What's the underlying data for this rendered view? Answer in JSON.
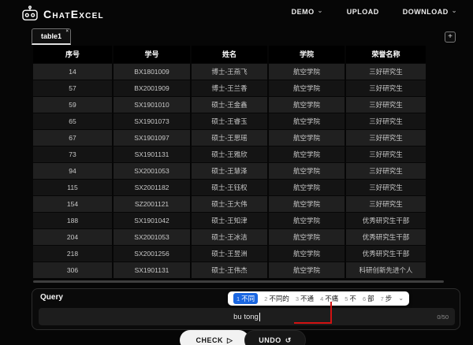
{
  "brand": {
    "p1": "C",
    "p2": "HAT",
    "p3": "E",
    "p4": "XCEL"
  },
  "nav": {
    "demo": "DEMO",
    "upload": "UPLOAD",
    "download": "DOWNLOAD",
    "chevron": "⌄"
  },
  "tabs": {
    "active": "table1",
    "close": "×",
    "add": "+"
  },
  "table": {
    "columns": [
      "序号",
      "学号",
      "姓名",
      "学院",
      "荣誉名称"
    ],
    "rows": [
      [
        "14",
        "BX1801009",
        "博士-王燕飞",
        "航空学院",
        "三好研究生"
      ],
      [
        "57",
        "BX2001909",
        "博士-王兰香",
        "航空学院",
        "三好研究生"
      ],
      [
        "59",
        "SX1901010",
        "硕士-王金鑫",
        "航空学院",
        "三好研究生"
      ],
      [
        "65",
        "SX1901073",
        "硕士-王睿玉",
        "航空学院",
        "三好研究生"
      ],
      [
        "67",
        "SX1901097",
        "硕士-王思瑶",
        "航空学院",
        "三好研究生"
      ],
      [
        "73",
        "SX1901131",
        "硕士-王雅欣",
        "航空学院",
        "三好研究生"
      ],
      [
        "94",
        "SX2001053",
        "硕士-王慧泽",
        "航空学院",
        "三好研究生"
      ],
      [
        "115",
        "SX2001182",
        "硕士-王钰权",
        "航空学院",
        "三好研究生"
      ],
      [
        "154",
        "SZ2001121",
        "硕士-王大伟",
        "航空学院",
        "三好研究生"
      ],
      [
        "188",
        "SX1901042",
        "硕士-王知津",
        "航空学院",
        "优秀研究生干部"
      ],
      [
        "204",
        "SX2001053",
        "硕士-王冰洁",
        "航空学院",
        "优秀研究生干部"
      ],
      [
        "218",
        "SX2001256",
        "硕士-王昱洲",
        "航空学院",
        "优秀研究生干部"
      ],
      [
        "306",
        "SX1901131",
        "硕士-王伟杰",
        "航空学院",
        "科研创新先进个人"
      ]
    ]
  },
  "query": {
    "label": "Query",
    "input_value": "bu tong",
    "char_counter": "0/50"
  },
  "ime": {
    "candidates": [
      {
        "num": "1",
        "text": "不同",
        "selected": true
      },
      {
        "num": "2",
        "text": "不同的",
        "selected": false
      },
      {
        "num": "3",
        "text": "不通",
        "selected": false
      },
      {
        "num": "4",
        "text": "不痛",
        "selected": false
      },
      {
        "num": "5",
        "text": "不",
        "selected": false
      },
      {
        "num": "6",
        "text": "部",
        "selected": false
      },
      {
        "num": "7",
        "text": "步",
        "selected": false
      }
    ],
    "chevron": "⌄",
    "highlight_color": "#1a66e0"
  },
  "actions": {
    "check": "CHECK",
    "check_icon": "▷",
    "undo": "UNDO",
    "undo_icon": "↺"
  },
  "annotation": {
    "color": "#d11212"
  }
}
